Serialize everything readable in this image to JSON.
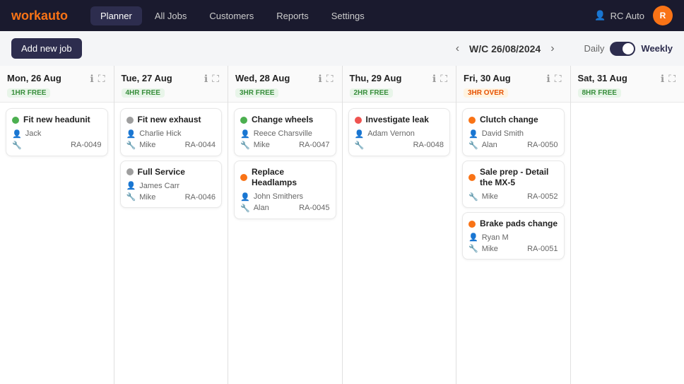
{
  "navbar": {
    "logo_prefix": "work",
    "logo_accent": "auto",
    "links": [
      {
        "label": "Planner",
        "active": true
      },
      {
        "label": "All Jobs",
        "active": false
      },
      {
        "label": "Customers",
        "active": false
      },
      {
        "label": "Reports",
        "active": false
      },
      {
        "label": "Settings",
        "active": false
      }
    ],
    "user_label": "RC Auto",
    "user_initials": "R"
  },
  "toolbar": {
    "add_job_label": "Add new job",
    "week_label": "W/C 26/08/2024",
    "view_daily": "Daily",
    "view_weekly": "Weekly"
  },
  "days": [
    {
      "title": "Mon, 26 Aug",
      "badge": "1HR FREE",
      "badge_type": "free",
      "jobs": [
        {
          "dot": "green",
          "title": "Fit new headunit",
          "person": "Jack",
          "id": "RA-0049"
        }
      ]
    },
    {
      "title": "Tue, 27 Aug",
      "badge": "4HR FREE",
      "badge_type": "free",
      "jobs": [
        {
          "dot": "gray",
          "title": "Fit new exhaust",
          "person": "Charlie Hick",
          "assignee": "Mike",
          "id": "RA-0044"
        },
        {
          "dot": "gray",
          "title": "Full Service",
          "person": "James Carr",
          "assignee": "Mike",
          "id": "RA-0046"
        }
      ]
    },
    {
      "title": "Wed, 28 Aug",
      "badge": "3HR FREE",
      "badge_type": "free",
      "jobs": [
        {
          "dot": "green",
          "title": "Change wheels",
          "person": "Reece Charsville",
          "assignee": "Mike",
          "id": "RA-0047"
        },
        {
          "dot": "orange",
          "title": "Replace Headlamps",
          "person": "John Smithers",
          "assignee": "Alan",
          "id": "RA-0045"
        }
      ]
    },
    {
      "title": "Thu, 29 Aug",
      "badge": "2HR FREE",
      "badge_type": "free",
      "jobs": [
        {
          "dot": "red",
          "title": "Investigate leak",
          "person": "Adam Vernon",
          "id": "RA-0048"
        }
      ]
    },
    {
      "title": "Fri, 30 Aug",
      "badge": "3HR OVER",
      "badge_type": "over",
      "jobs": [
        {
          "dot": "orange",
          "title": "Clutch change",
          "person": "David Smith",
          "assignee": "Alan",
          "id": "RA-0050"
        },
        {
          "dot": "orange",
          "title": "Sale prep - Detail the MX-5",
          "person": "",
          "assignee": "Mike",
          "id": "RA-0052"
        },
        {
          "dot": "orange",
          "title": "Brake pads change",
          "person": "Ryan M",
          "assignee": "Mike",
          "id": "RA-0051"
        }
      ]
    },
    {
      "title": "Sat, 31 Aug",
      "badge": "8HR FREE",
      "badge_type": "free",
      "jobs": []
    }
  ]
}
